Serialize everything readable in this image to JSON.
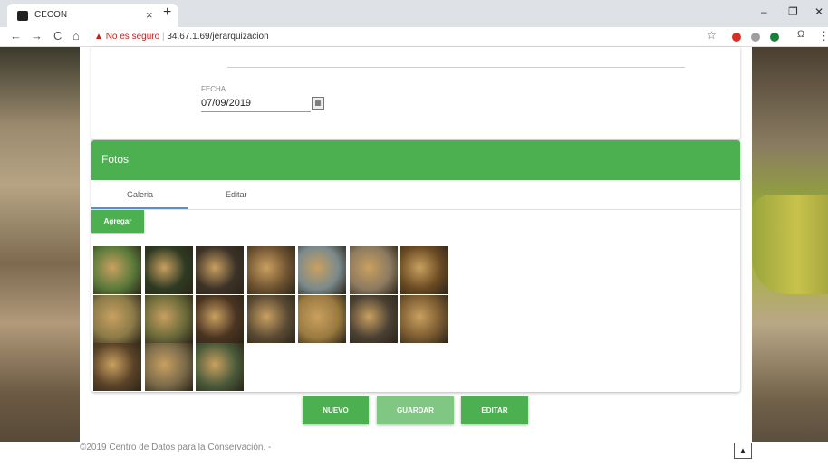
{
  "browser": {
    "tab_title": "CECON",
    "tab_close": "×",
    "new_tab": "+",
    "win_min": "–",
    "win_max": "❐",
    "win_close": "✕",
    "back": "←",
    "forward": "→",
    "reload": "C",
    "home": "⌂",
    "warning_icon": "▲",
    "security_text": "No es seguro",
    "separator": "|",
    "url": "34.67.1.69/jerarquizacion",
    "star": "☆",
    "menu": "⋮",
    "profile": "Ω"
  },
  "form": {
    "fecha_label": "FECHA",
    "fecha_value": "07/09/2019",
    "calendar_icon": "▦"
  },
  "fotos": {
    "title": "Fotos",
    "tabs": [
      "Galeria",
      "Editar"
    ],
    "agregar_label": "Agregar",
    "photos": [
      {
        "color": "#5a7a3a"
      },
      {
        "color": "#2e3a22"
      },
      {
        "color": "#3c3228"
      },
      {
        "color": "#6e5230"
      },
      {
        "color": "#7a8a8c"
      },
      {
        "color": "#8c7a60"
      },
      {
        "color": "#6a4a22"
      },
      {
        "color": "#8a7a48"
      },
      {
        "color": "#6a6a3a"
      },
      {
        "color": "#4a3422"
      },
      {
        "color": "#5a4a34"
      },
      {
        "color": "#9a7a40"
      },
      {
        "color": "#4a4034"
      },
      {
        "color": "#7a5a30"
      },
      {
        "color": "#5a4228"
      },
      {
        "color": "#7a6a4a"
      },
      {
        "color": "#4a5a3a"
      }
    ]
  },
  "actions": {
    "nuevo": "NUEVO",
    "guardar": "GUARDAR",
    "editar": "EDITAR"
  },
  "footer": {
    "text": "©2019 Centro de Datos para la Conservación. -",
    "to_top_icon": "▲"
  },
  "colors": {
    "primary_green": "#4caf50",
    "disabled_green": "#81c784",
    "tab_indicator": "#5b8ec7"
  }
}
